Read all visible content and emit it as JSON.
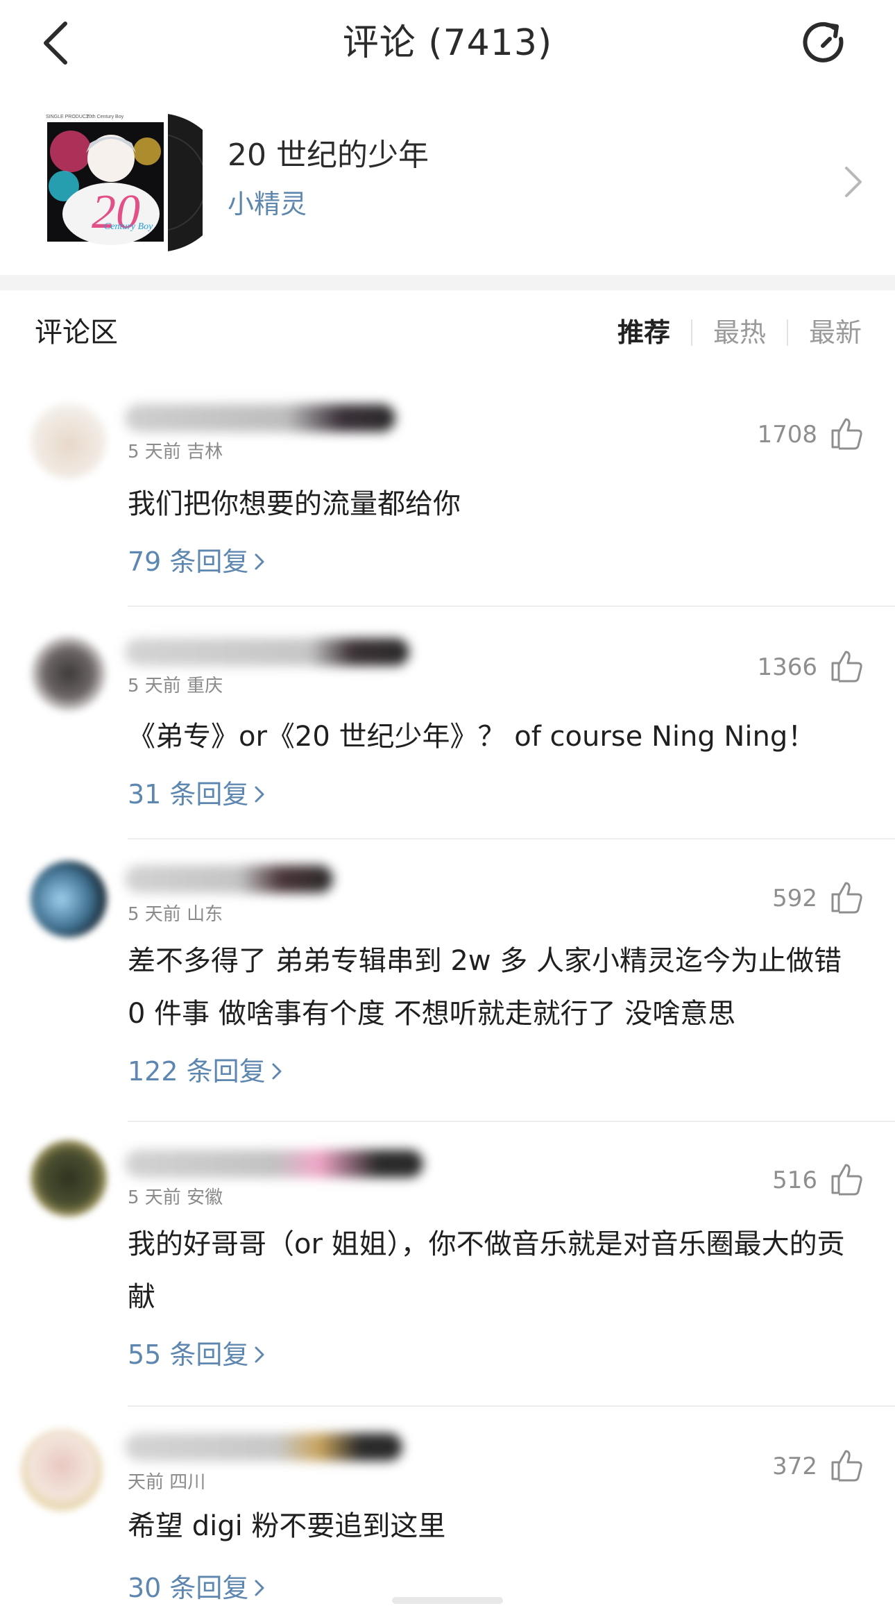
{
  "header": {
    "title": "评论 (7413)",
    "back_icon": "chevron-left-icon",
    "refresh_icon": "refresh-icon"
  },
  "song": {
    "title": "20 世纪的少年",
    "artist": "小精灵",
    "cover_text": {
      "top_left": "SINGLE PRODUCT",
      "top_mid": "20th Century Boy",
      "big": "20",
      "script": "Century Boy"
    }
  },
  "section": {
    "title": "评论区",
    "tabs": [
      {
        "label": "推荐",
        "active": true
      },
      {
        "label": "最热",
        "active": false
      },
      {
        "label": "最新",
        "active": false
      }
    ]
  },
  "comments": [
    {
      "meta": "5 天前  吉林",
      "likes": "1708",
      "text": "我们把你想要的流量都给你",
      "replies": "79 条回复"
    },
    {
      "meta": "5 天前  重庆",
      "likes": "1366",
      "text": "《弟专》or《20 世纪少年》？ of course Ning Ning！",
      "replies": "31 条回复"
    },
    {
      "meta": "5 天前  山东",
      "likes": "592",
      "text": "差不多得了 弟弟专辑串到 2w 多 人家小精灵迄今为止做错 0 件事 做啥事有个度 不想听就走就行了 没啥意思",
      "replies": "122 条回复"
    },
    {
      "meta": "5 天前  安徽",
      "likes": "516",
      "text": "我的好哥哥（or 姐姐），你不做音乐就是对音乐圈最大的贡献",
      "replies": "55 条回复"
    },
    {
      "meta": "天前  四川",
      "likes": "372",
      "text": "希望 digi 粉不要追到这里",
      "replies": "30 条回复"
    }
  ],
  "colors": {
    "link": "#5d87b0",
    "muted": "#8e8e8e",
    "text": "#1f1f1f"
  }
}
